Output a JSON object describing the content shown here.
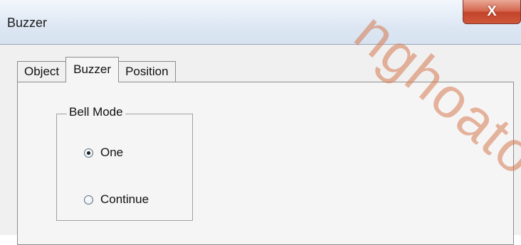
{
  "window": {
    "title": "Buzzer",
    "close_glyph": "X"
  },
  "tabs": [
    {
      "label": "Object",
      "active": false
    },
    {
      "label": "Buzzer",
      "active": true
    },
    {
      "label": "Position",
      "active": false
    }
  ],
  "bell_mode": {
    "legend": "Bell Mode",
    "options": [
      {
        "label": "One",
        "checked": true
      },
      {
        "label": "Continue",
        "checked": false
      }
    ]
  },
  "watermark": "nghoato"
}
